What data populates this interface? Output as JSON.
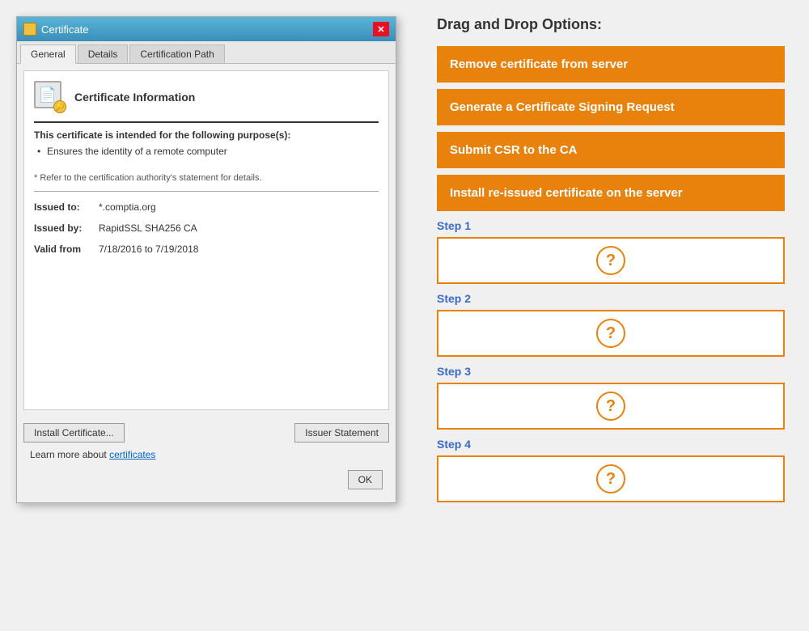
{
  "dialog": {
    "title": "Certificate",
    "tabs": [
      {
        "label": "General",
        "active": true
      },
      {
        "label": "Details",
        "active": false
      },
      {
        "label": "Certification Path",
        "active": false
      }
    ],
    "cert_info_title": "Certificate Information",
    "purpose_title": "This certificate is intended for the following purpose(s):",
    "purpose_items": [
      "Ensures the identity of a remote computer"
    ],
    "authority_note": "* Refer to the certification authority's statement for details.",
    "fields": [
      {
        "label": "Issued to:",
        "value": "*.comptia.org"
      },
      {
        "label": "Issued by:",
        "value": "RapidSSL SHA256 CA"
      },
      {
        "label": "Valid from",
        "value": "7/18/2016 to 7/19/2018"
      }
    ],
    "btn_install": "Install Certificate...",
    "btn_issuer": "Issuer Statement",
    "link_text": "Learn more about",
    "link_label": "certificates",
    "btn_ok": "OK"
  },
  "right": {
    "title": "Drag and Drop Options:",
    "options": [
      "Remove certificate from server",
      "Generate a Certificate Signing Request",
      "Submit CSR to the CA",
      "Install re-issued certificate on the server"
    ],
    "steps": [
      {
        "label": "Step 1"
      },
      {
        "label": "Step 2"
      },
      {
        "label": "Step 3"
      },
      {
        "label": "Step 4"
      }
    ]
  }
}
